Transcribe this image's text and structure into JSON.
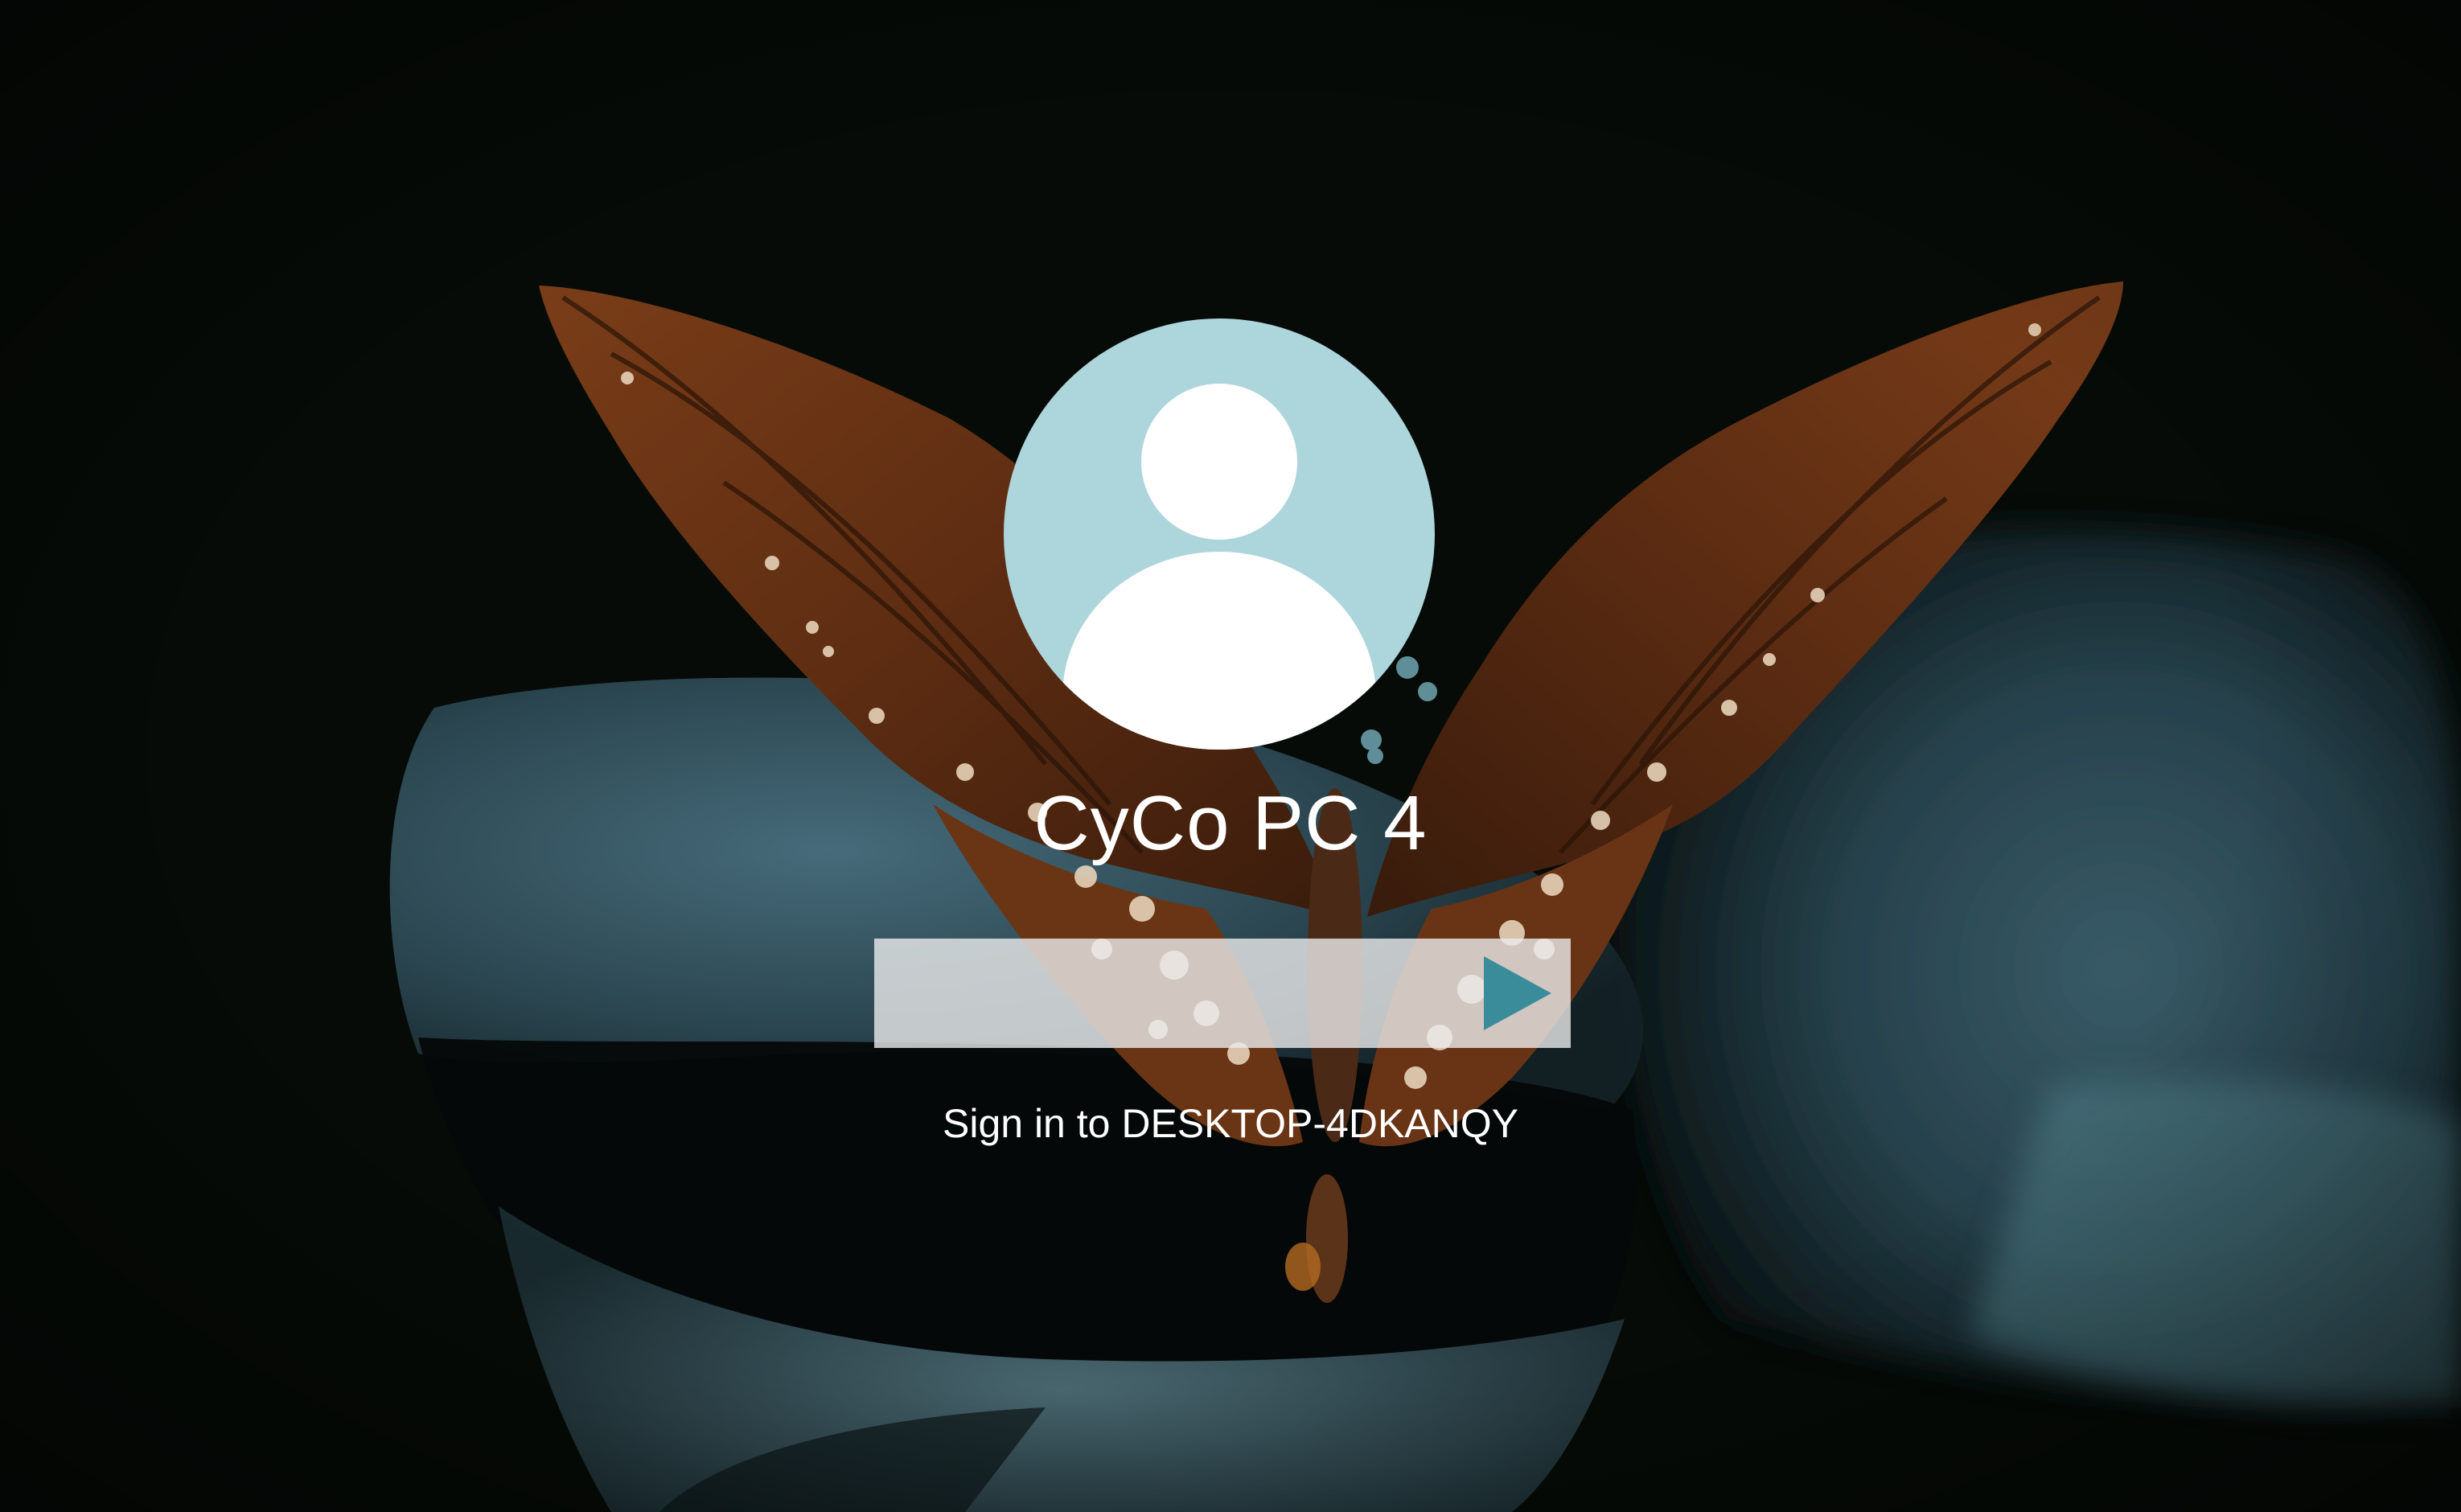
{
  "login": {
    "username": "CyCo PC 4",
    "password": {
      "value": "",
      "placeholder": ""
    },
    "submit_icon": "arrow-right-icon",
    "signin_prompt": "Sign in to DESKTOP-4DKANQY"
  },
  "avatar_icon": "user-silhouette-icon",
  "wallpaper": "butterfly-on-leaf",
  "colors": {
    "avatar_bg": "#add5dc",
    "avatar_figure": "#ffffff",
    "submit_arrow": "#3b8c9a",
    "text": "#ffffff",
    "input_bg": "rgba(235,235,235,0.80)",
    "background": "#060a06"
  }
}
